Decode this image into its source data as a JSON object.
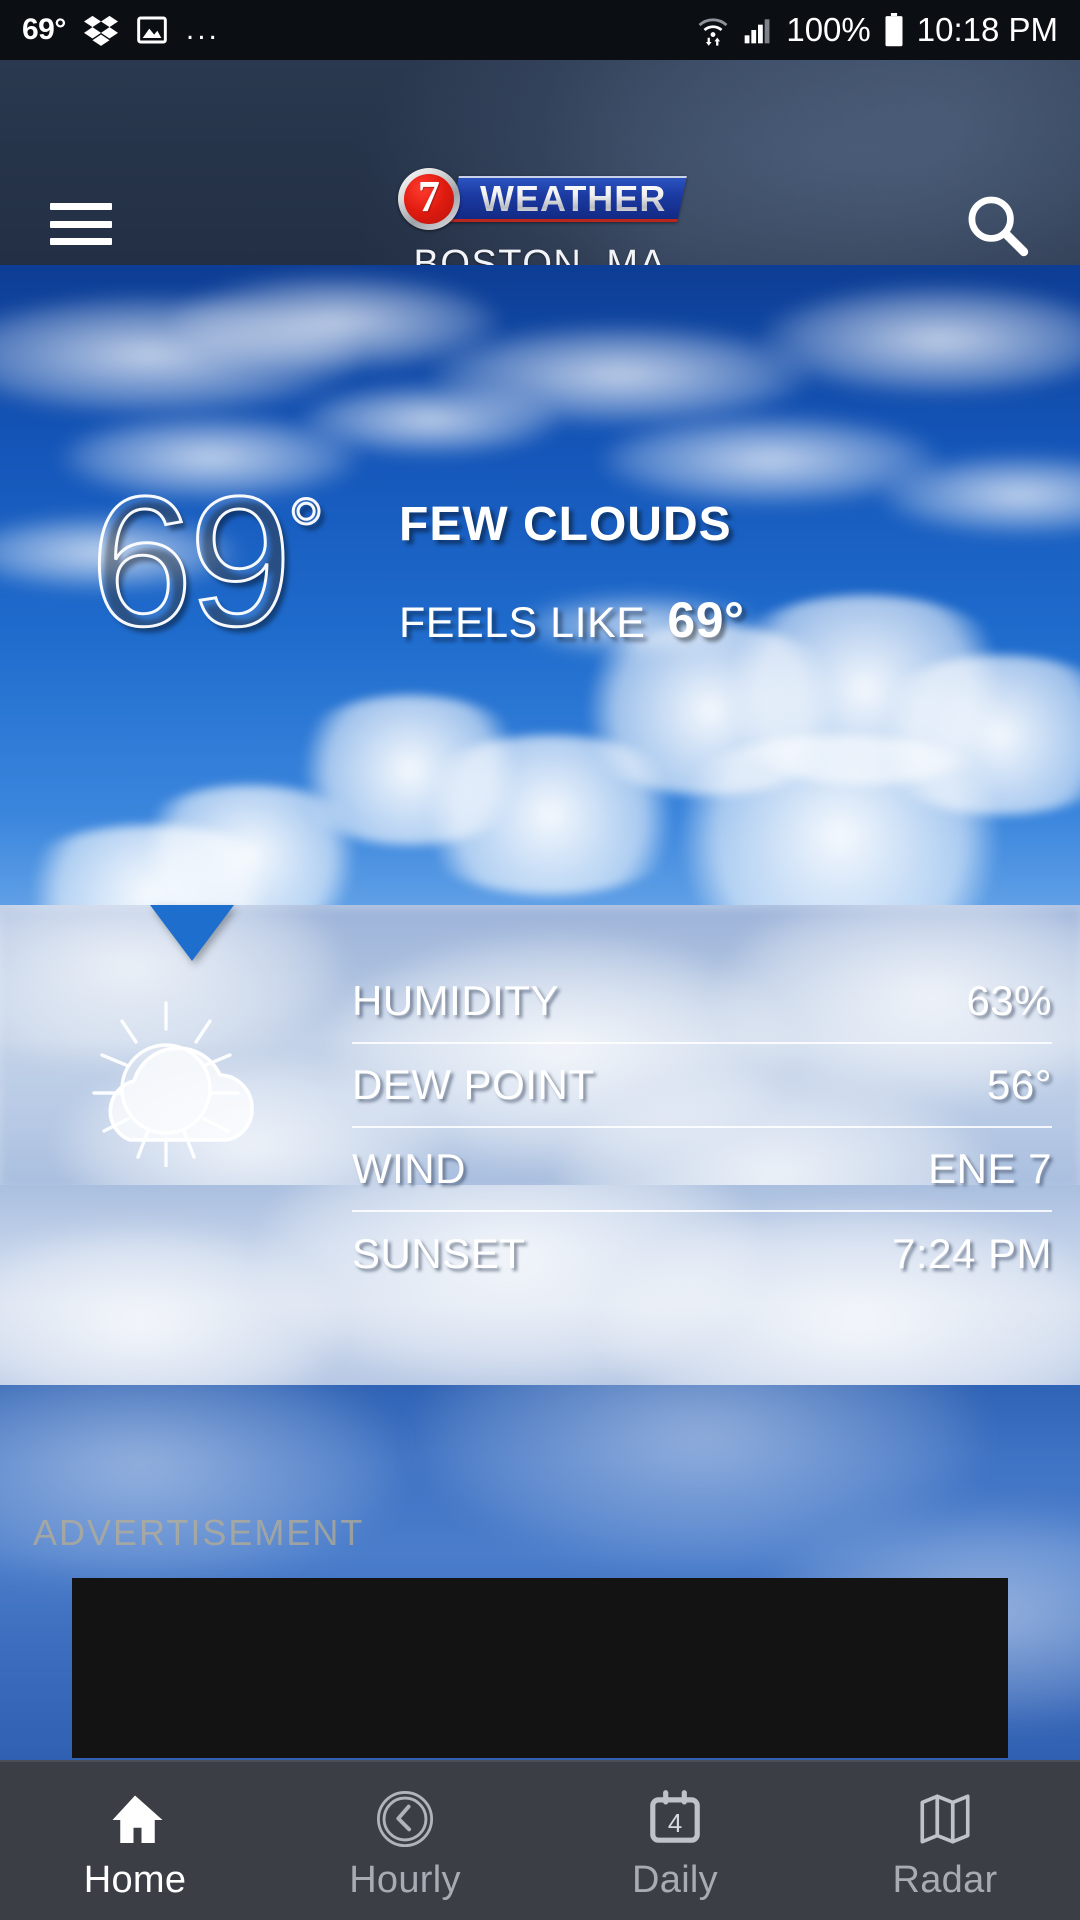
{
  "statusbar": {
    "temperature": "69°",
    "dropbox_icon": "dropbox-icon",
    "gallery_icon": "gallery-icon",
    "overflow": "...",
    "wifi_icon": "wifi-icon",
    "signal_icon": "cellular-signal-icon",
    "battery_percent": "100%",
    "battery_icon": "battery-full-icon",
    "clock": "10:18 PM"
  },
  "header": {
    "menu_icon": "hamburger-menu-icon",
    "search_icon": "search-icon",
    "logo_number": "7",
    "logo_word": "WEATHER",
    "city": "BOSTON, MA"
  },
  "current": {
    "temperature": "69",
    "degree": "°",
    "condition": "FEW CLOUDS",
    "feels_like_label": "FEELS LIKE",
    "feels_like_value": "69°"
  },
  "details": {
    "weather_icon": "sun-behind-cloud-icon",
    "rows": [
      {
        "label": "HUMIDITY",
        "value": "63%"
      },
      {
        "label": "DEW POINT",
        "value": "56°"
      },
      {
        "label": "WIND",
        "value": "ENE 7"
      },
      {
        "label": "SUNSET",
        "value": "7:24 PM"
      }
    ]
  },
  "advertisement": {
    "label": "ADVERTISEMENT"
  },
  "nav": {
    "items": [
      {
        "label": "Home",
        "icon": "home-icon",
        "active": true
      },
      {
        "label": "Hourly",
        "icon": "clock-icon",
        "active": false
      },
      {
        "label": "Daily",
        "icon": "calendar-icon",
        "active": false,
        "badge": "4"
      },
      {
        "label": "Radar",
        "icon": "map-icon",
        "active": false
      }
    ]
  },
  "colors": {
    "header_bg": "#26344a",
    "sky_top": "#0d3d94",
    "panel": "#b9cbe6",
    "nav_bg": "#3b3e45",
    "ad_bg": "#131313",
    "accent_red": "#e01b10",
    "accent_blue": "#1b39a0"
  }
}
